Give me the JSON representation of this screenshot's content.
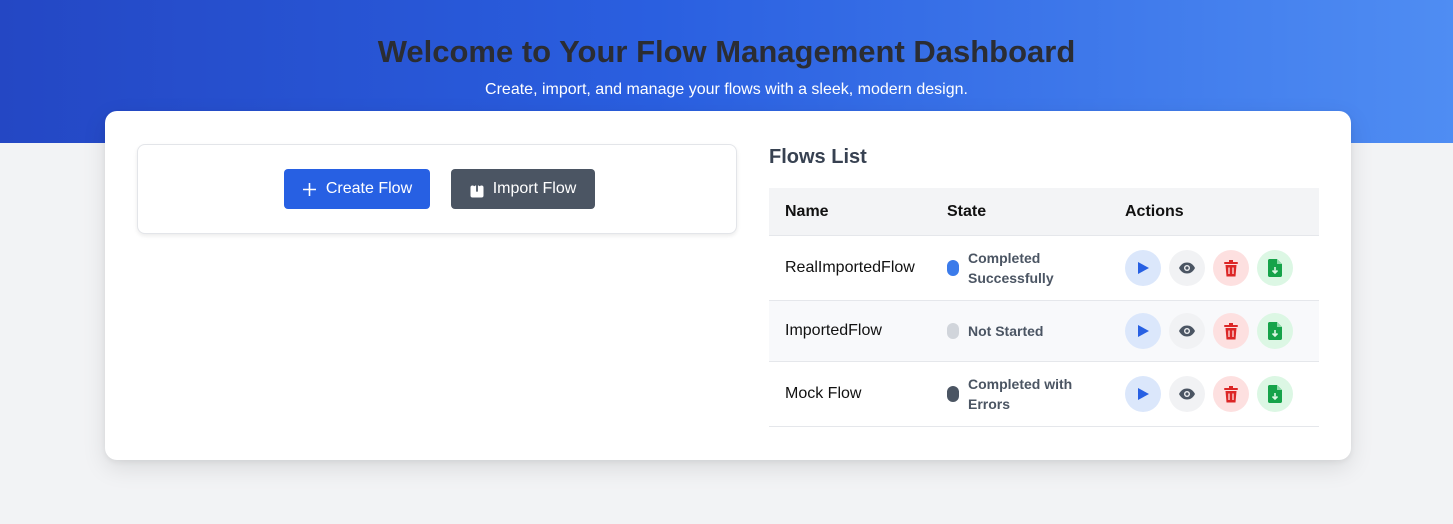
{
  "hero": {
    "title": "Welcome to Your Flow Management Dashboard",
    "subtitle": "Create, import, and manage your flows with a sleek, modern design."
  },
  "toolbar": {
    "create_label": "Create Flow",
    "import_label": "Import Flow",
    "create_icon": "plus-icon",
    "import_icon": "upload-icon"
  },
  "flows": {
    "title": "Flows List",
    "columns": [
      "Name",
      "State",
      "Actions"
    ],
    "rows": [
      {
        "name": "RealImportedFlow",
        "state": "Completed Successfully",
        "state_color": "#3b7bea"
      },
      {
        "name": "ImportedFlow",
        "state": "Not Started",
        "state_color": "#d1d5db"
      },
      {
        "name": "Mock Flow",
        "state": "Completed with Errors",
        "state_color": "#4b5563"
      }
    ],
    "row_actions": [
      "play-icon",
      "eye-icon",
      "trash-icon",
      "file-export-icon"
    ]
  },
  "colors": {
    "primary": "#2760e3",
    "secondary": "#4b5563",
    "run": "#2760e3",
    "view": "#4b5563",
    "delete": "#dc2626",
    "export": "#16a34a"
  }
}
